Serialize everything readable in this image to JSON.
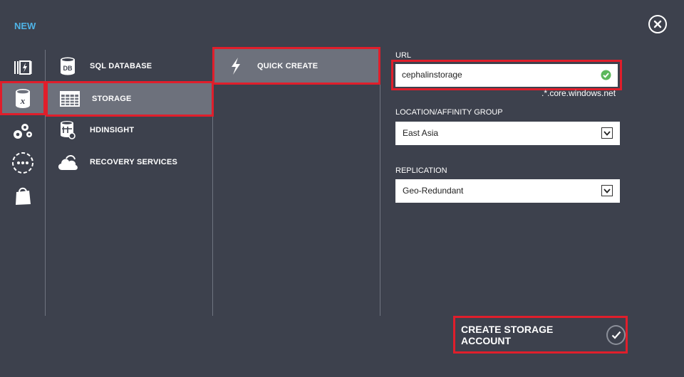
{
  "dialog": {
    "title": "NEW"
  },
  "icon_column": [
    {
      "name": "web-sites-icon"
    },
    {
      "name": "data-services-icon",
      "selected": true
    },
    {
      "name": "app-services-icon"
    },
    {
      "name": "network-services-icon"
    },
    {
      "name": "store-icon"
    }
  ],
  "services": [
    {
      "label": "SQL DATABASE",
      "icon": "db-icon"
    },
    {
      "label": "STORAGE",
      "icon": "storage-grid-icon",
      "selected": true
    },
    {
      "label": "HDINSIGHT",
      "icon": "hdinsight-icon"
    },
    {
      "label": "RECOVERY SERVICES",
      "icon": "cloud-icon"
    }
  ],
  "actions": [
    {
      "label": "QUICK CREATE",
      "icon": "lightning-icon",
      "selected": true
    }
  ],
  "form": {
    "url_label": "URL",
    "url_value": "cephalinstorage",
    "url_suffix": ".*.core.windows.net",
    "location_label": "LOCATION/AFFINITY GROUP",
    "location_value": "East Asia",
    "replication_label": "REPLICATION",
    "replication_value": "Geo-Redundant"
  },
  "create_button": {
    "label": "CREATE STORAGE ACCOUNT"
  },
  "colors": {
    "background": "#3d414d",
    "selected": "#6d717c",
    "highlight": "#e01e2b",
    "accent": "#4fb3e6",
    "valid": "#5cb85c"
  }
}
